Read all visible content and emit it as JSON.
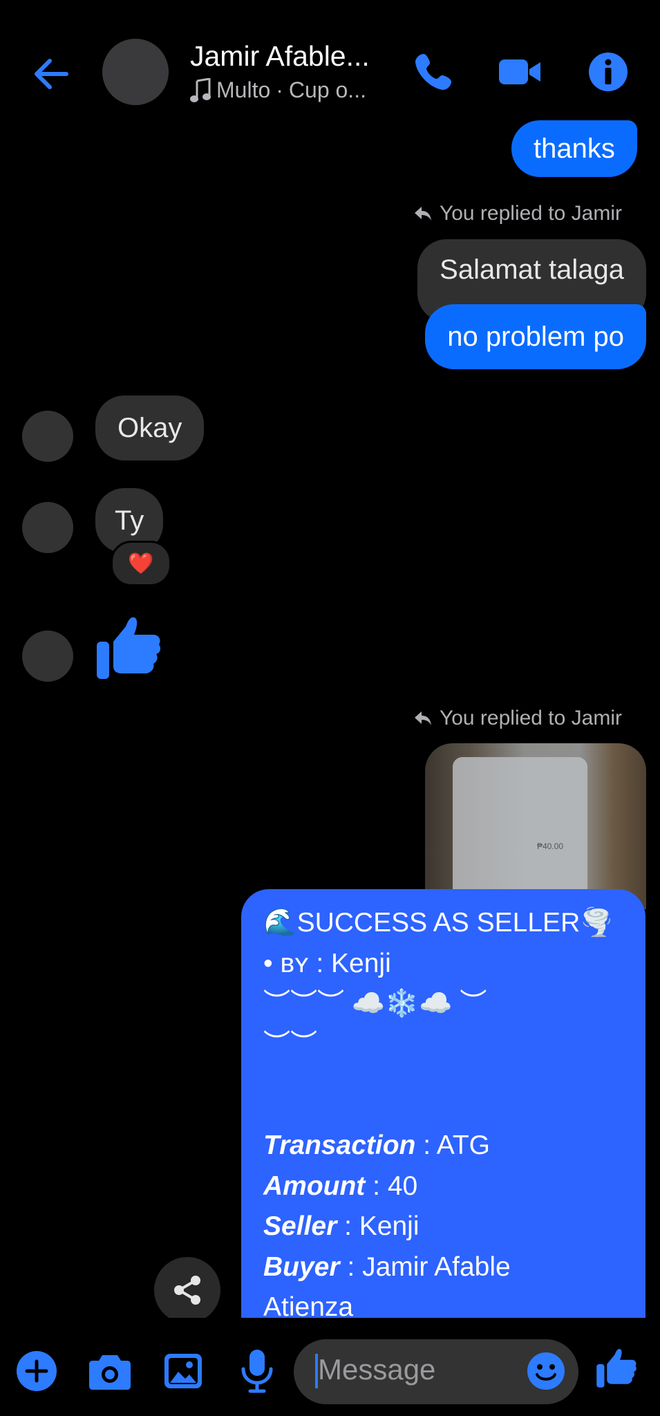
{
  "header": {
    "title": "Jamir Afable...",
    "subtitle_song": "Multo",
    "subtitle_sep": "·",
    "subtitle_artist": "Cup o..."
  },
  "messages": {
    "thanks": "thanks",
    "replied_1": "You replied to Jamir",
    "quoted_1": "Salamat talaga",
    "reply_1": "no problem po",
    "okay": "Okay",
    "ty": "Ty",
    "reaction": "❤️",
    "replied_2": "You replied to Jamir",
    "receipt_amount": "₱40.00"
  },
  "card": {
    "heading_emoji_left": "🌊",
    "heading": "SUCCESS AS SELLER",
    "heading_emoji_right": "🌪️",
    "by_prefix": "• ʙʏ",
    "by_sep": ":",
    "by_value": "Kenji",
    "deco_1": "︶︶︶ ☁️❄️☁️ ︶",
    "deco_2": "︶︶",
    "rows": [
      {
        "label": "Transaction",
        "sep": ":",
        "value": "ATG"
      },
      {
        "label": "Amount",
        "sep": ":",
        "value": "40"
      },
      {
        "label": "Seller",
        "sep": ":",
        "value": "Kenji"
      },
      {
        "label": "Buyer",
        "sep": ":",
        "value": "Jamir Afable"
      }
    ],
    "buyer_continued": "Atienza"
  },
  "composer": {
    "placeholder": "Message"
  },
  "colors": {
    "accent": "#0a6cff",
    "card": "#2d63ff",
    "bubble_gray": "#303030"
  },
  "icons": [
    "back-arrow-icon",
    "phone-icon",
    "video-camera-icon",
    "info-icon",
    "music-note-icon",
    "reply-arrow-icon",
    "thumbs-up-icon",
    "share-icon",
    "plus-icon",
    "camera-icon",
    "image-icon",
    "microphone-icon",
    "emoji-icon"
  ]
}
